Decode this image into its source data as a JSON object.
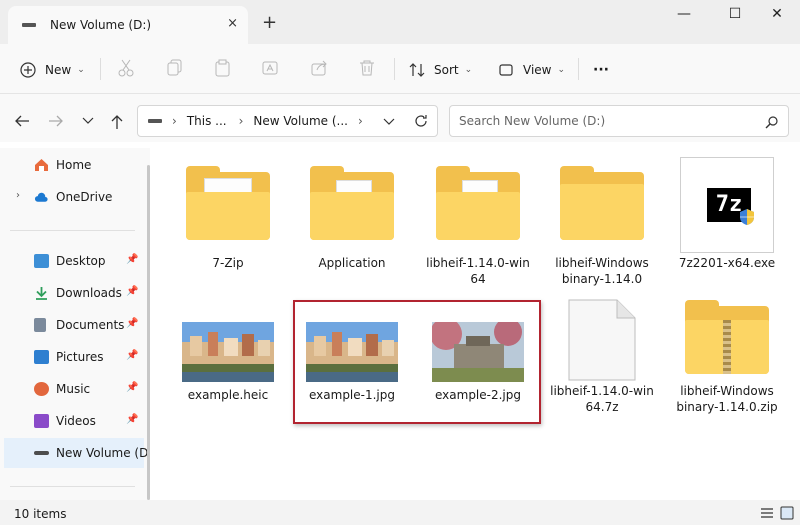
{
  "window": {
    "tab_title": "New Volume (D:)",
    "tab_close": "×",
    "new_tab": "+",
    "minimize": "—",
    "maximize": "☐",
    "close": "✕"
  },
  "toolbar": {
    "new_label": "New",
    "sort_label": "Sort",
    "view_label": "View",
    "more": "···"
  },
  "address": {
    "crumbs": [
      "This ...",
      "New Volume (..."
    ],
    "separator": "›"
  },
  "search": {
    "placeholder": "Search New Volume (D:)"
  },
  "sidebar": {
    "items": [
      {
        "label": "Home",
        "icon": "home-icon",
        "pinned": false
      },
      {
        "label": "OneDrive",
        "icon": "cloud-icon",
        "pinned": false
      },
      {
        "label": "Desktop",
        "icon": "desktop-icon",
        "pinned": true
      },
      {
        "label": "Downloads",
        "icon": "download-icon",
        "pinned": true
      },
      {
        "label": "Documents",
        "icon": "document-icon",
        "pinned": true
      },
      {
        "label": "Pictures",
        "icon": "picture-icon",
        "pinned": true
      },
      {
        "label": "Music",
        "icon": "music-icon",
        "pinned": true
      },
      {
        "label": "Videos",
        "icon": "video-icon",
        "pinned": true
      },
      {
        "label": "New Volume (D:)",
        "icon": "drive-icon",
        "pinned": false
      }
    ]
  },
  "files": [
    {
      "name": "7-Zip",
      "type": "folder"
    },
    {
      "name": "Application",
      "type": "folder"
    },
    {
      "name": "libheif-1.14.0-win64",
      "type": "folder",
      "cap_line1": "libheif-1.14.0-win",
      "cap_line2": "64"
    },
    {
      "name": "libheif-Windows binary-1.14.0",
      "type": "folder",
      "cap_line1": "libheif-Windows",
      "cap_line2": "binary-1.14.0"
    },
    {
      "name": "7z2201-x64.exe",
      "type": "exe"
    },
    {
      "name": "example.heic",
      "type": "image"
    },
    {
      "name": "example-1.jpg",
      "type": "image"
    },
    {
      "name": "example-2.jpg",
      "type": "image"
    },
    {
      "name": "libheif-1.14.0-win64.7z",
      "type": "file",
      "cap_line1": "libheif-1.14.0-win",
      "cap_line2": "64.7z"
    },
    {
      "name": "libheif-Windows binary-1.14.0.zip",
      "type": "zip",
      "cap_line1": "libheif-Windows",
      "cap_line2": "binary-1.14.0.zip"
    }
  ],
  "exe_icon_text": "7z",
  "status": {
    "item_count": "10 items"
  },
  "colors": {
    "highlight_border": "#b22430",
    "folder": "#f2c04d",
    "selection": "#e5f0fb"
  }
}
